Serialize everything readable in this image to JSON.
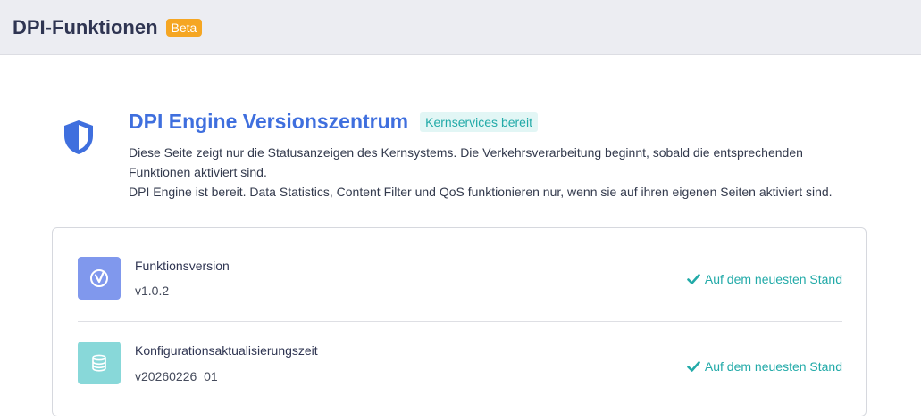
{
  "header": {
    "title": "DPI-Funktionen",
    "badge": "Beta"
  },
  "hero": {
    "icon": "shield-icon",
    "title": "DPI Engine Versionszentrum",
    "status_badge": "Kernservices bereit",
    "description_1": "Diese Seite zeigt nur die Statusanzeigen des Kernsystems. Die Verkehrsverarbeitung beginnt, sobald die entsprechenden Funktionen aktiviert sind.",
    "description_2": "DPI Engine ist bereit. Data Statistics, Content Filter und QoS funktionieren nur, wenn sie auf ihren eigenen Seiten aktiviert sind."
  },
  "versions": [
    {
      "icon": "version-check-icon",
      "label": "Funktionsversion",
      "value": "v1.0.2",
      "status": "Auf dem neuesten Stand"
    },
    {
      "icon": "database-icon",
      "label": "Konfigurationsaktualisierungszeit",
      "value": "v20260226_01",
      "status": "Auf dem neuesten Stand"
    }
  ],
  "colors": {
    "accent_blue": "#3f6fde",
    "accent_teal": "#22aaa8",
    "beta_orange": "#f5a623",
    "icon_blue_bg": "#8098ed",
    "icon_teal_bg": "#88d8d9"
  }
}
